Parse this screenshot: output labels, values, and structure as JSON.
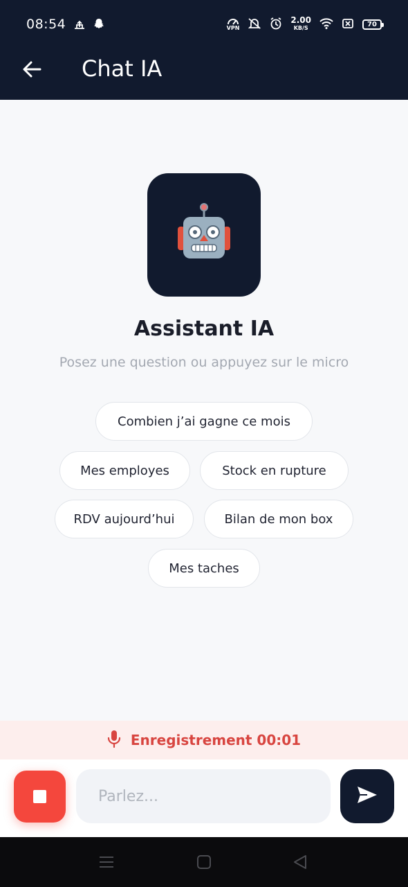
{
  "status_bar": {
    "time": "08:54",
    "speed_value": "2.00",
    "speed_unit": "KB/S",
    "vpn_label": "VPN",
    "battery": "70",
    "left_icons": [
      "cloud-upload-icon",
      "snapchat-icon"
    ],
    "right_icons": [
      "vpn-icon",
      "mute-icon",
      "alarm-icon",
      "wifi-icon",
      "no-sim-icon",
      "battery-icon"
    ]
  },
  "app_bar": {
    "title": "Chat IA",
    "back_icon": "arrow-left-icon"
  },
  "assistant": {
    "avatar_icon": "robot-icon",
    "title": "Assistant IA",
    "subtitle": "Posez une question ou appuyez sur le micro"
  },
  "suggestions": [
    "Combien j’ai gagne ce mois",
    "Mes employes",
    "Stock en rupture",
    "RDV aujourd’hui",
    "Bilan de mon box",
    "Mes taches"
  ],
  "recording": {
    "icon": "microphone-icon",
    "label": "Enregistrement 00:01"
  },
  "input": {
    "placeholder": "Parlez...",
    "value": "",
    "stop_icon": "stop-icon",
    "send_icon": "send-icon"
  },
  "nav_bar": {
    "icons": [
      "menu-icon",
      "home-icon",
      "back-triangle-icon"
    ]
  },
  "colors": {
    "header_bg": "#111a2e",
    "accent_red": "#f4473d",
    "recording_text": "#d84540",
    "recording_bg": "#fdeeed",
    "page_bg": "#f7f8fa"
  }
}
